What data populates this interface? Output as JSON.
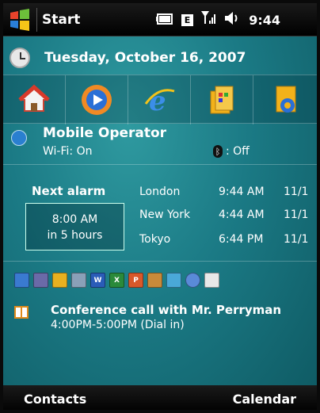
{
  "statusbar": {
    "start_label": "Start",
    "network_badge": "E",
    "signal": "Yl",
    "volume": "◀",
    "time": "9:44"
  },
  "today": {
    "date": "Tuesday, October 16, 2007"
  },
  "launcher": [
    "home-icon",
    "media-player-icon",
    "internet-explorer-icon",
    "file-explorer-icon",
    "settings-icon"
  ],
  "operator": {
    "name": "Mobile Operator",
    "wifi": "Wi-Fi: On",
    "bluetooth": ": Off"
  },
  "alarm": {
    "title": "Next alarm",
    "time": "8:00 AM",
    "remaining": "in 5 hours"
  },
  "world_clock": [
    {
      "city": "London",
      "time": "9:44 AM",
      "date": "11/1"
    },
    {
      "city": "New York",
      "time": "4:44 AM",
      "date": "11/1"
    },
    {
      "city": "Tokyo",
      "time": "6:44 PM",
      "date": "11/1"
    }
  ],
  "appointment": {
    "subject": "Conference call with Mr. Perryman",
    "when": "4:00PM-5:00PM (Dial in)"
  },
  "softkeys": {
    "left": "Contacts",
    "right": "Calendar"
  },
  "colors": {
    "background": "#1b7a85",
    "bar": "#000000"
  }
}
